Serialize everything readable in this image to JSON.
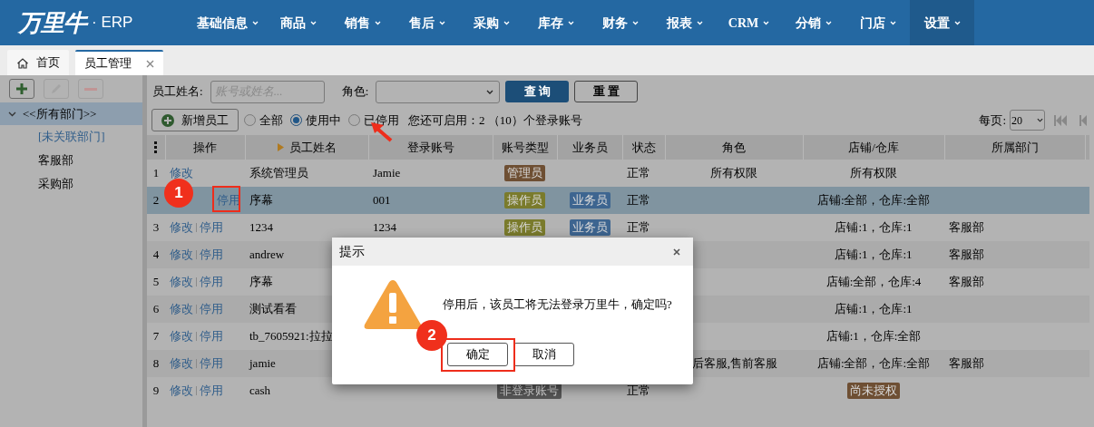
{
  "app": {
    "logo": "万里牛",
    "product": "· ERP"
  },
  "nav": [
    {
      "label": "基础信息",
      "selected": false
    },
    {
      "label": "商品",
      "selected": false
    },
    {
      "label": "销售",
      "selected": false
    },
    {
      "label": "售后",
      "selected": false
    },
    {
      "label": "采购",
      "selected": false
    },
    {
      "label": "库存",
      "selected": false
    },
    {
      "label": "财务",
      "selected": false
    },
    {
      "label": "报表",
      "selected": false
    },
    {
      "label": "CRM",
      "selected": false
    },
    {
      "label": "分销",
      "selected": false
    },
    {
      "label": "门店",
      "selected": false
    },
    {
      "label": "设置",
      "selected": true
    }
  ],
  "tabs": [
    {
      "label": "首页",
      "kind": "home",
      "selected": false,
      "closable": false
    },
    {
      "label": "员工管理",
      "kind": "page",
      "selected": true,
      "closable": true
    }
  ],
  "sidebar": {
    "tools": [
      {
        "kind": "add",
        "disabled": false
      },
      {
        "kind": "edit",
        "disabled": true
      },
      {
        "kind": "remove",
        "disabled": true
      }
    ],
    "tree": [
      {
        "label": "<<所有部门>>",
        "expanded": true,
        "selected": true,
        "children": [
          {
            "label": "[未关联部门]",
            "kind": "unassigned",
            "selected": false
          },
          {
            "label": "客服部",
            "kind": "dept",
            "selected": false
          },
          {
            "label": "采购部",
            "kind": "dept",
            "selected": false
          }
        ]
      }
    ]
  },
  "filters": {
    "name_field": {
      "label": "员工姓名:",
      "placeholder": "账号或姓名..."
    },
    "role_field": {
      "label": "角色:"
    },
    "buttons": [
      {
        "label": "查 询",
        "kind": "primary"
      },
      {
        "label": "重 置",
        "kind": "default"
      }
    ]
  },
  "toolbar": {
    "add_button": "新增员工",
    "status_options": [
      {
        "label": "全部",
        "selected": false
      },
      {
        "label": "使用中",
        "selected": true
      },
      {
        "label": "已停用",
        "selected": false
      }
    ],
    "quota": "您还可启用：2 （10）个登录账号",
    "page_size_label": "每页:",
    "page_size": "20"
  },
  "table": {
    "columns": [
      "操作",
      "员工姓名",
      "登录账号",
      "账号类型",
      "业务员",
      "状态",
      "角色",
      "店铺/仓库",
      "所属部门"
    ],
    "rows": [
      {
        "index": "1",
        "selected": false,
        "actions": [
          "修改"
        ],
        "name": "系统管理员",
        "login": "Jamie",
        "type": {
          "text": "管理员",
          "color": "#6e4f33"
        },
        "status": "正常",
        "role": "所有权限",
        "store": "所有权限"
      },
      {
        "index": "2",
        "selected": true,
        "marker": "1",
        "actions": [
          "停用"
        ],
        "name": "序幕",
        "login": "001",
        "type": {
          "text": "操作员",
          "color": "#7a7b2c"
        },
        "salesman": {
          "text": "业务员",
          "color": "#3d6590"
        },
        "status": "正常",
        "store": "店铺:全部，仓库:全部"
      },
      {
        "index": "3",
        "selected": false,
        "actions": [
          "修改",
          "停用"
        ],
        "name": "1234",
        "login": "1234",
        "type": {
          "text": "操作员",
          "color": "#7a7b2c"
        },
        "salesman": {
          "text": "业务员",
          "color": "#3d6590"
        },
        "status": "正常",
        "store": "店铺:1，仓库:1",
        "dept": "客服部"
      },
      {
        "index": "4",
        "selected": false,
        "actions": [
          "修改",
          "停用"
        ],
        "name": "andrew",
        "store": "店铺:1，仓库:1",
        "dept": "客服部"
      },
      {
        "index": "5",
        "selected": false,
        "actions": [
          "修改",
          "停用"
        ],
        "name": "序幕",
        "store": "店铺:全部，仓库:4",
        "dept": "客服部"
      },
      {
        "index": "6",
        "selected": false,
        "actions": [
          "修改",
          "停用"
        ],
        "name": "测试看看",
        "store": "店铺:1，仓库:1"
      },
      {
        "index": "7",
        "selected": false,
        "actions": [
          "修改",
          "停用"
        ],
        "name": "tb_7605921:拉拉",
        "store": "店铺:1，仓库:全部"
      },
      {
        "index": "8",
        "selected": false,
        "actions": [
          "修改",
          "停用"
        ],
        "name": "jamie",
        "role": "后客服,售前客服",
        "store": "店铺:全部，仓库:全部",
        "dept": "客服部"
      },
      {
        "index": "9",
        "selected": false,
        "actions": [
          "修改",
          "停用"
        ],
        "name": "cash",
        "type": {
          "text": "非登录账号",
          "color": "#555555"
        },
        "status": "正常",
        "store_badge": {
          "text": "尚未授权",
          "color": "#6e4f33"
        }
      }
    ]
  },
  "dialog": {
    "title": "提示",
    "message": "停用后，该员工将无法登录万里牛，确定吗?",
    "marker": "2",
    "buttons": [
      "确定",
      "取消"
    ]
  }
}
